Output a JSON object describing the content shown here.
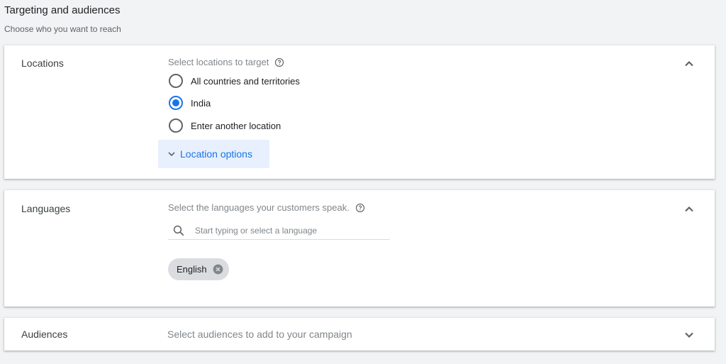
{
  "header": {
    "title": "Targeting and audiences",
    "subtitle": "Choose who you want to reach"
  },
  "locations": {
    "label": "Locations",
    "hint": "Select locations to target",
    "options": [
      {
        "label": "All countries and territories",
        "selected": false
      },
      {
        "label": "India",
        "selected": true
      },
      {
        "label": "Enter another location",
        "selected": false
      }
    ],
    "more_button": "Location options",
    "expanded": true
  },
  "languages": {
    "label": "Languages",
    "hint": "Select the languages your customers speak.",
    "search_placeholder": "Start typing or select a language",
    "search_value": "",
    "chips": [
      {
        "label": "English"
      }
    ],
    "expanded": true
  },
  "audiences": {
    "label": "Audiences",
    "hint": "Select audiences to add to your campaign",
    "expanded": false
  },
  "colors": {
    "accent": "#1a73e8",
    "background": "#f1f3f4"
  }
}
